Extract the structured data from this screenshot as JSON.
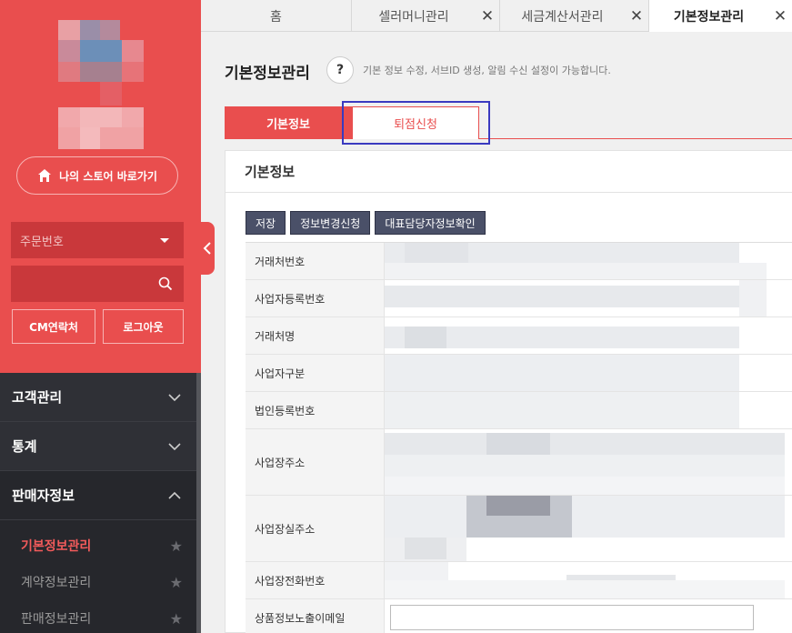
{
  "sidebar": {
    "store_button": "나의 스토어 바로가기",
    "order_select_placeholder": "주문번호",
    "search_placeholder": "",
    "cm_button": "CM연락처",
    "logout_button": "로그아웃",
    "menu": [
      {
        "label": "고객관리",
        "open": false
      },
      {
        "label": "통계",
        "open": false
      },
      {
        "label": "판매자정보",
        "open": true
      }
    ],
    "submenu": [
      {
        "label": "기본정보관리",
        "active": true
      },
      {
        "label": "계약정보관리",
        "active": false
      },
      {
        "label": "판매정보관리",
        "active": false
      }
    ]
  },
  "tabs": [
    {
      "label": "홈",
      "closable": false
    },
    {
      "label": "셀러머니관리",
      "closable": true
    },
    {
      "label": "세금계산서관리",
      "closable": true
    },
    {
      "label": "기본정보관리",
      "closable": true,
      "active": true
    }
  ],
  "page": {
    "title": "기본정보관리",
    "help": "?",
    "description": "기본 정보 수정, 서브ID 생성, 알림 수신 설정이 가능합니다.",
    "sub_tabs": [
      "기본정보",
      "퇴점신청"
    ],
    "panel_title": "기본정보",
    "actions": [
      "저장",
      "정보변경신청",
      "대표담당자정보확인"
    ],
    "fields": [
      "거래처번호",
      "사업자등록번호",
      "거래처명",
      "사업자구분",
      "법인등록번호",
      "사업장주소",
      "사업장실주소",
      "사업장전화번호",
      "상품정보노출이메일"
    ]
  },
  "colors": {
    "accent": "#e94e4e",
    "sidebar_dark": "#2f3036",
    "button_dark": "#4a5068",
    "highlight": "#3a3ac0"
  }
}
